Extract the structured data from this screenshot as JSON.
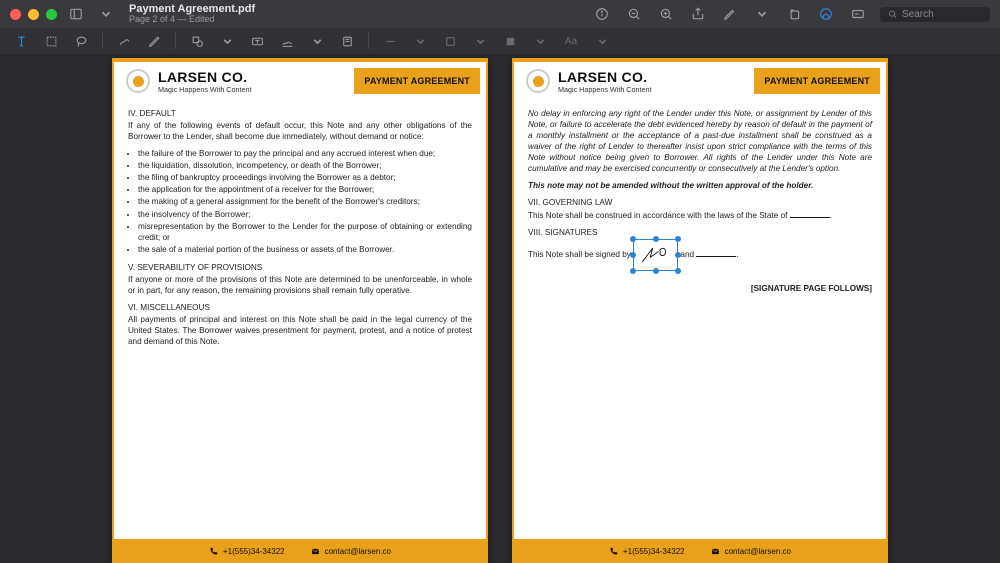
{
  "window": {
    "title": "Payment Agreement.pdf",
    "subtitle": "Page 2 of 4 — Edited"
  },
  "search": {
    "placeholder": "Search"
  },
  "doc": {
    "company": {
      "name": "LARSEN CO.",
      "tagline": "Magic Happens With Content"
    },
    "header_badge": "PAYMENT AGREEMENT",
    "footer": {
      "phone": "+1(555)34-34322",
      "email": "contact@larsen.co"
    }
  },
  "page_left": {
    "s4_title": "IV. DEFAULT",
    "s4_intro": "If any of the following events of default occur, this Note and any other obligations of the Borrower to the Lender, shall become due immediately, without demand or notice:",
    "s4_bullets": [
      "the failure of the Borrower to pay the principal and any accrued interest when due;",
      "the liquidation, dissolution, incompetency, or death of the Borrower;",
      "the filing of bankruptcy proceedings involving the Borrower as a debtor;",
      "the application for the appointment of a receiver for the Borrower;",
      "the making of a general assignment for the benefit of the Borrower's creditors;",
      "the insolvency of the Borrower;",
      "misrepresentation by the Borrower to the Lender for the purpose of obtaining or extending credit; or",
      "the sale of a material portion of the business or assets of the Borrower."
    ],
    "s5_title": "V. SEVERABILITY OF PROVISIONS",
    "s5_body": "If anyone or more of the provisions of this Note are determined to be unenforceable, in whole or in part, for any reason, the remaining provisions shall remain fully operative.",
    "s6_title": "VI. MISCELLANEOUS",
    "s6_body": "All payments of principal and interest on this Note shall be paid in the legal currency of the United States. The Borrower waives presentment for payment, protest, and a notice of protest and demand of this Note."
  },
  "page_right": {
    "misc_italic": "No delay in enforcing any right of the Lender under this Note, or assignment by Lender of this Note, or failure to accelerate the debt evidenced hereby by reason of default in the payment of a monthly installment or the acceptance of a past-due installment shall be construed as a waiver of the right of Lender to thereafter insist upon strict compliance with the terms of this Note without notice being given to Borrower. All rights of the Lender under this Note are cumulative and may be exercised concurrently or consecutively at the Lender's option.",
    "amend_line": "This note may not be amended without the written approval of the holder.",
    "s7_title": "VII. GOVERNING LAW",
    "s7_body_pre": "This Note shall be construed in accordance with the laws of the State of ",
    "s7_body_post": ".",
    "s8_title": "VIII. SIGNATURES",
    "s8_pre": "This Note shall be signed by ",
    "s8_mid": " and ",
    "s8_post": ".",
    "sig_follow": "[SIGNATURE PAGE FOLLOWS]"
  }
}
